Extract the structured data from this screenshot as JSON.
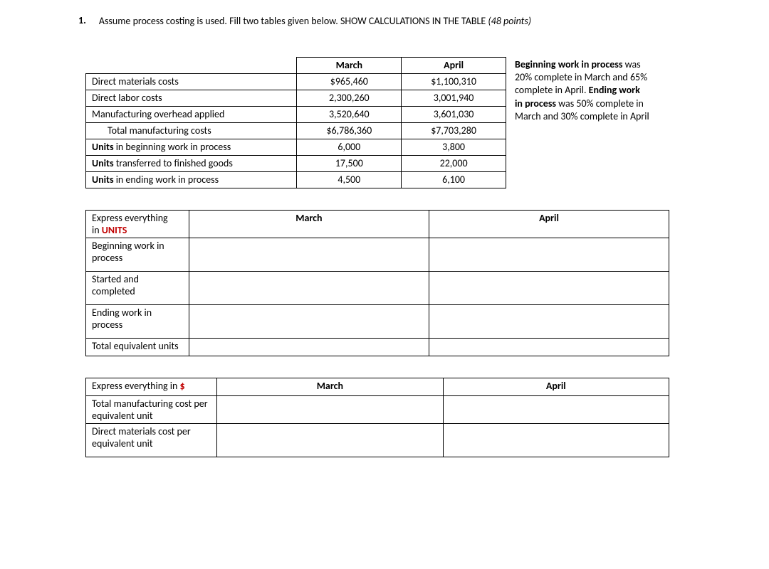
{
  "question": {
    "number": "1.",
    "text_part1": "Assume process costing is used.  Fill two tables given below. SHOW CALCULATIONS IN THE TABLE ",
    "text_part2": "(48 points)"
  },
  "table1": {
    "headers": {
      "c2": "March",
      "c3": "April"
    },
    "rows": [
      {
        "label": "Direct materials costs",
        "march": "$965,460",
        "april": "$1,100,310"
      },
      {
        "label": "Direct labor costs",
        "march": "2,300,260",
        "april": "3,001,940"
      },
      {
        "label": "Manufacturing overhead applied",
        "march": "3,520,640",
        "april": "3,601,030"
      },
      {
        "label": "Total manufacturing costs",
        "march": "$6,786,360",
        "april": "$7,703,280",
        "indent": true
      },
      {
        "label_prefix": "Units",
        "label_rest": " in beginning work in process",
        "march": "6,000",
        "april": "3,800"
      },
      {
        "label_prefix": "Units",
        "label_rest": " transferred to finished goods",
        "march": "17,500",
        "april": "22,000"
      },
      {
        "label_prefix": "Units",
        "label_rest": " in ending work in process",
        "march": "4,500",
        "april": "6,100"
      }
    ],
    "note": {
      "l1a": "Beginning work in process ",
      "l1b": "was",
      "l2": "20% complete in March and 65%",
      "l3a": "complete in April. ",
      "l3b": "Ending work",
      "l4a": "in process ",
      "l4b": "was 50% complete in",
      "l5": "March and 30% complete in April"
    }
  },
  "table2": {
    "header_label1": "Express everything",
    "header_label2": "in ",
    "header_label3": "UNITS",
    "col_march": "March",
    "col_april": "April",
    "rows": [
      "Beginning work in process",
      "Started and completed",
      "Ending work in process",
      "Total equivalent units"
    ]
  },
  "table3": {
    "header_label1": "Express everything in ",
    "header_label2": "$",
    "col_march": "March",
    "col_april": "April",
    "rows": [
      "Total manufacturing cost per equivalent unit",
      "Direct materials cost per equivalent unit"
    ]
  }
}
